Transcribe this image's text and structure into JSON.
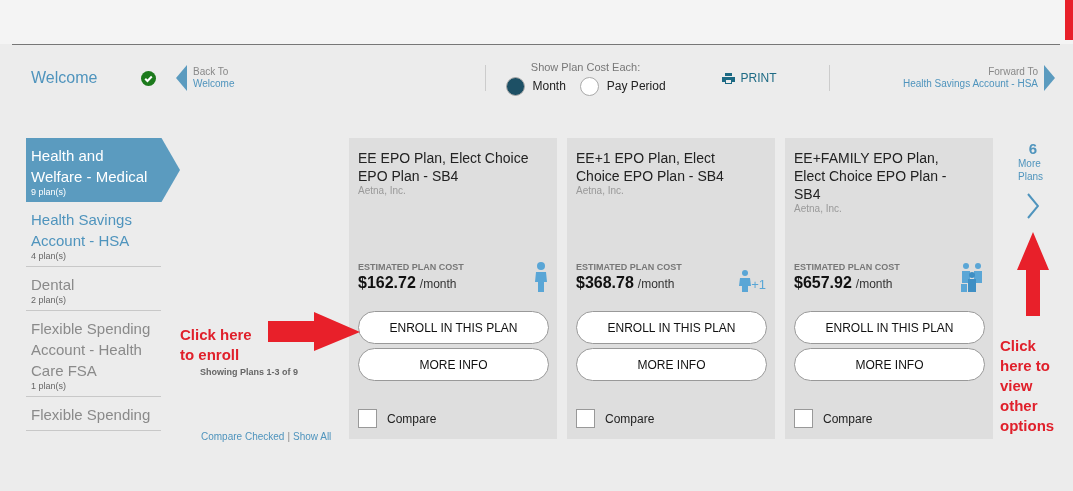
{
  "header": {
    "welcome": {
      "label": "Welcome",
      "completed": true
    },
    "back": {
      "caption": "Back To",
      "target": "Welcome"
    },
    "cost_toggle": {
      "label": "Show Plan Cost Each:",
      "options": [
        {
          "label": "Month",
          "selected": true
        },
        {
          "label": "Pay Period",
          "selected": false
        }
      ]
    },
    "print": "PRINT",
    "forward": {
      "caption": "Forward To",
      "target": "Health Savings Account - HSA"
    }
  },
  "sidebar": {
    "items": [
      {
        "title": "Health and Welfare - Medical",
        "count": "9 plan(s)",
        "selected": true,
        "linked": true
      },
      {
        "title": "Health Savings Account - HSA",
        "count": "4 plan(s)",
        "selected": false,
        "linked": true
      },
      {
        "title": "Dental",
        "count": "2 plan(s)",
        "selected": false,
        "linked": false
      },
      {
        "title": "Flexible Spending Account - Health Care FSA",
        "count": "1 plan(s)",
        "selected": false,
        "linked": false
      },
      {
        "title": "Flexible Spending",
        "selected": false,
        "linked": false
      }
    ]
  },
  "enroll_annotation": "Click here to enroll",
  "showing": "Showing Plans 1-3 of 9",
  "compare_links": {
    "items": [
      "Compare Checked",
      "Show All"
    ],
    "separator": "|"
  },
  "plans": [
    {
      "name": "EE EPO Plan, Elect Choice EPO Plan - SB4",
      "provider": "Aetna, Inc.",
      "cost_label": "ESTIMATED PLAN COST",
      "price": "$162.72",
      "period": "/month",
      "kind": "single",
      "enroll": "ENROLL IN THIS PLAN",
      "more": "MORE INFO",
      "compare": {
        "label": "Compare",
        "checked": false
      }
    },
    {
      "name": "EE+1 EPO Plan, Elect Choice EPO Plan - SB4",
      "provider": "Aetna, Inc.",
      "cost_label": "ESTIMATED PLAN COST",
      "price": "$368.78",
      "period": "/month",
      "kind": "plus_one",
      "badge": "+1",
      "enroll": "ENROLL IN THIS PLAN",
      "more": "MORE INFO",
      "compare": {
        "label": "Compare",
        "checked": false
      }
    },
    {
      "name": "EE+FAMILY EPO Plan, Elect Choice EPO Plan - SB4",
      "provider": "Aetna, Inc.",
      "cost_label": "ESTIMATED PLAN COST",
      "price": "$657.92",
      "period": "/month",
      "kind": "family",
      "enroll": "ENROLL IN THIS PLAN",
      "more": "MORE INFO",
      "compare": {
        "label": "Compare",
        "checked": false
      }
    }
  ],
  "more_plans": {
    "count": "6",
    "label": "More Plans"
  },
  "more_annotation": "Click here to view other options"
}
